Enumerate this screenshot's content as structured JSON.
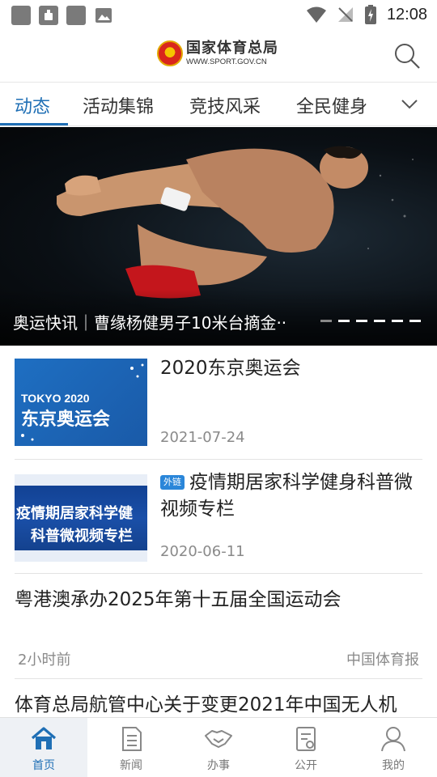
{
  "status_bar": {
    "time": "12:08"
  },
  "header": {
    "logo_cn": "国家体育总局",
    "logo_en": "WWW.SPORT.GOV.CN"
  },
  "tabs": [
    {
      "label": "动态",
      "active": true
    },
    {
      "label": "活动集锦"
    },
    {
      "label": "竞技风采"
    },
    {
      "label": "全民健身"
    }
  ],
  "banner": {
    "caption": "奥运快讯｜曹缘杨健男子10米台摘金··",
    "slide_count": 6,
    "current_slide": 1
  },
  "news": [
    {
      "title": "2020东京奥运会",
      "date": "2021-07-24",
      "thumb_text_top": "TOKYO 2020",
      "thumb_text_bottom": "东京奥运会"
    },
    {
      "badge": "外链",
      "title": "疫情期居家科学健身科普微视频专栏",
      "date": "2020-06-11",
      "thumb_text_top": "疫情期居家科学健",
      "thumb_text_bottom": "科普微视频专栏"
    },
    {
      "title": "粤港澳承办2025年第十五届全国运动会",
      "time": "2小时前",
      "source": "中国体育报"
    },
    {
      "title": "体育总局航管中心关于变更2021年中国无人机"
    }
  ],
  "bottom_nav": [
    {
      "label": "首页",
      "icon": "home-icon",
      "active": true
    },
    {
      "label": "新闻",
      "icon": "news-icon"
    },
    {
      "label": "办事",
      "icon": "handshake-icon"
    },
    {
      "label": "公开",
      "icon": "public-doc-icon"
    },
    {
      "label": "我的",
      "icon": "user-icon"
    }
  ],
  "colors": {
    "accent": "#1f6fb5",
    "badge": "#2a86d9",
    "text": "#222222",
    "muted": "#8a8a8a"
  }
}
